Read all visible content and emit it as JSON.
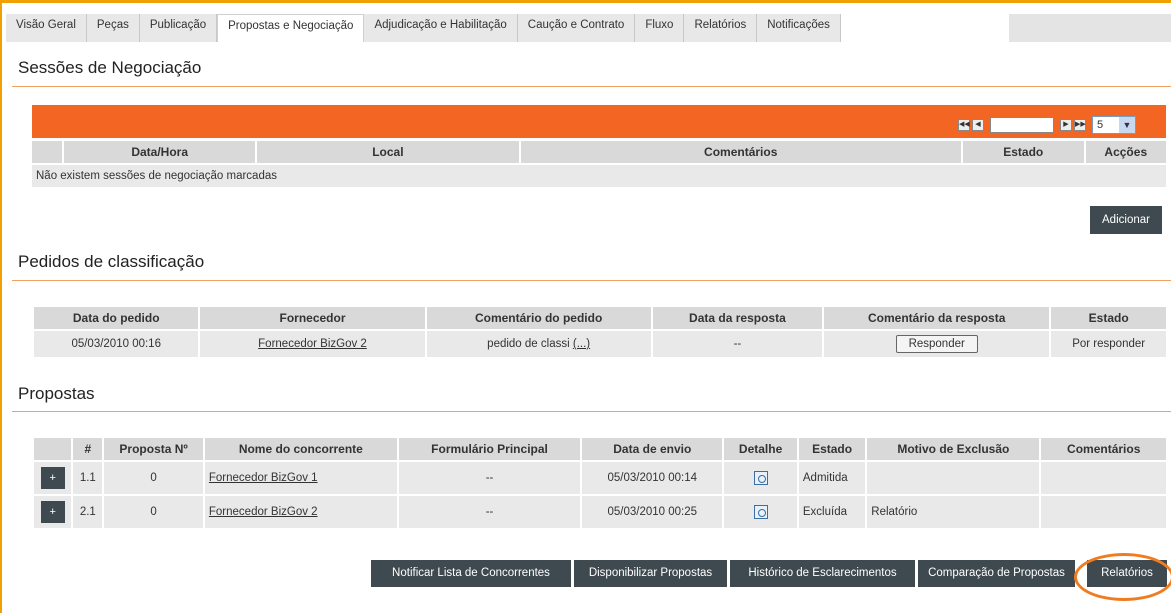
{
  "tabs": [
    {
      "label": "Visão Geral"
    },
    {
      "label": "Peças"
    },
    {
      "label": "Publicação"
    },
    {
      "label": "Propostas e Negociação"
    },
    {
      "label": "Adjudicação e Habilitação"
    },
    {
      "label": "Caução e Contrato"
    },
    {
      "label": "Fluxo"
    },
    {
      "label": "Relatórios"
    },
    {
      "label": "Notificações"
    }
  ],
  "active_tab": "Propostas e Negociação",
  "sessoes": {
    "title": "Sessões de Negociação",
    "page_size": "5",
    "columns": [
      "Data/Hora",
      "Local",
      "Comentários",
      "Estado",
      "Acções"
    ],
    "empty_message": "Não existem sessões de negociação marcadas",
    "add_button": "Adicionar"
  },
  "pedidos": {
    "title": "Pedidos de classificação",
    "columns": [
      "Data do pedido",
      "Fornecedor",
      "Comentário do pedido",
      "Data da resposta",
      "Comentário da resposta",
      "Estado"
    ],
    "rows": [
      {
        "data_pedido": "05/03/2010 00:16",
        "fornecedor": "Fornecedor BizGov 2",
        "comentario": "pedido de classi",
        "comentario_more": "(...)",
        "data_resposta": "--",
        "responder": "Responder",
        "estado": "Por responder"
      }
    ]
  },
  "propostas": {
    "title": "Propostas",
    "columns": [
      "",
      "#",
      "Proposta Nº",
      "Nome do concorrente",
      "Formulário Principal",
      "Data de envio",
      "Detalhe",
      "Estado",
      "Motivo de Exclusão",
      "Comentários"
    ],
    "rows": [
      {
        "expand": "+",
        "num": "1.1",
        "proposta": "0",
        "concorrente": "Fornecedor BizGov 1",
        "formulario": "--",
        "data_envio": "05/03/2010 00:14",
        "estado": "Admitida",
        "motivo": "",
        "comentarios": ""
      },
      {
        "expand": "+",
        "num": "2.1",
        "proposta": "0",
        "concorrente": "Fornecedor BizGov 2",
        "formulario": "--",
        "data_envio": "05/03/2010 00:25",
        "estado": "Excluída",
        "motivo": "Relatório",
        "comentarios": ""
      }
    ]
  },
  "actions": {
    "notificar": "Notificar Lista de Concorrentes",
    "disponibilizar": "Disponibilizar Propostas",
    "historico": "Histórico de Esclarecimentos",
    "comparacao": "Comparação de Propostas",
    "relatorios": "Relatórios"
  },
  "colors": {
    "accent": "#f26522",
    "frame": "#f0a000",
    "button": "#3e4a4f",
    "highlight": "#f07c20"
  }
}
